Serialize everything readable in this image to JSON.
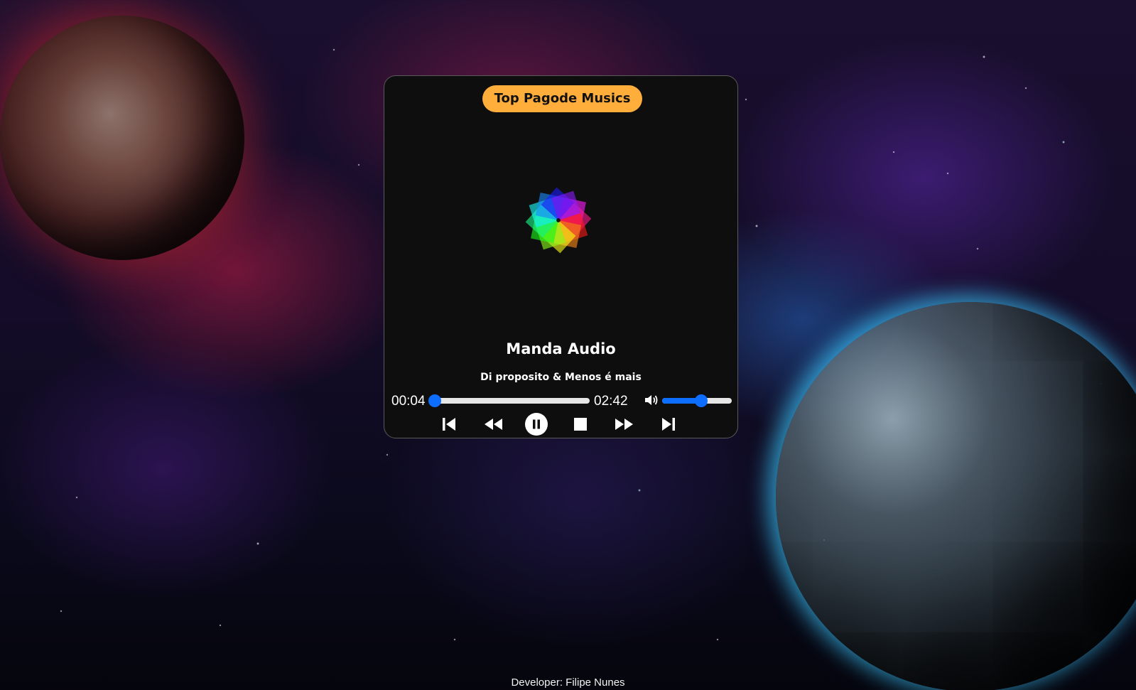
{
  "background": {
    "scene": "space-nebula"
  },
  "player": {
    "playlist_label": "Top Pagode Musics",
    "artwork_icon": "color-wheel-art-icon",
    "song_title": "Manda Audio",
    "artist": "Di proposito & Menos é mais",
    "current_time": "00:04",
    "total_time": "02:42",
    "progress_fraction": 0.025,
    "volume_fraction": 0.56,
    "controls": {
      "previous_icon": "skip-previous-icon",
      "rewind_icon": "rewind-icon",
      "pause_icon": "pause-icon",
      "stop_icon": "stop-icon",
      "forward_icon": "fast-forward-icon",
      "next_icon": "skip-next-icon",
      "volume_icon": "volume-icon"
    },
    "colors": {
      "accent": "#0d6efd",
      "pill": "#ffad3b",
      "panel": "#0e0e0e"
    }
  },
  "footer": {
    "text": "Developer: Filipe Nunes"
  }
}
